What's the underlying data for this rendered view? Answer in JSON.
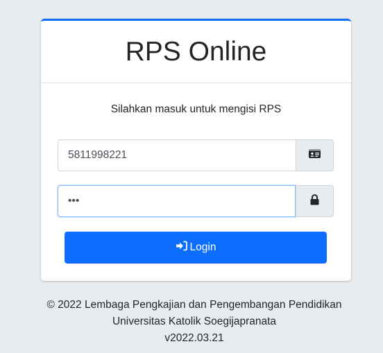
{
  "app": {
    "title": "RPS Online",
    "instruction": "Silahkan masuk untuk mengisi RPS"
  },
  "form": {
    "username_value": "5811998221",
    "password_value": "•••",
    "username_icon": "id-card-icon",
    "password_icon": "lock-icon",
    "login_label": "Login",
    "login_icon": "sign-in-icon"
  },
  "footer": {
    "line1": "© 2022 Lembaga Pengkajian dan Pengembangan Pendidikan",
    "line2": "Universitas Katolik Soegijapranata",
    "line3": "v2022.03.21"
  },
  "colors": {
    "accent": "#0d6efd",
    "background": "#e9ecef"
  }
}
